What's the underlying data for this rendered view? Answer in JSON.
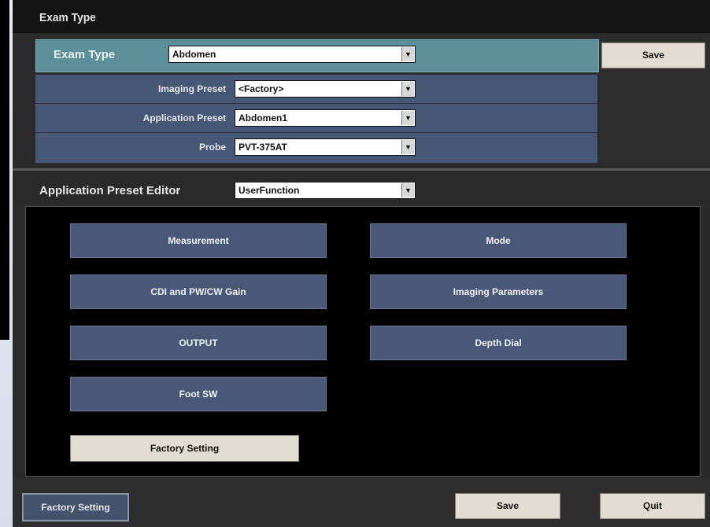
{
  "window": {
    "title": "Exam Type"
  },
  "exam_type": {
    "label": "Exam Type",
    "value": "Abdomen"
  },
  "presets": {
    "imaging_preset": {
      "label": "Imaging Preset",
      "value": "<Factory>"
    },
    "application_preset": {
      "label": "Application Preset",
      "value": "Abdomen1"
    },
    "probe": {
      "label": "Probe",
      "value": "PVT-375AT"
    }
  },
  "top_save_label": "Save",
  "editor": {
    "title": "Application Preset Editor",
    "selected": "UserFunction",
    "buttons": {
      "measurement": "Measurement",
      "mode": "Mode",
      "cdi_gain": "CDI and PW/CW Gain",
      "imaging_parameters": "Imaging Parameters",
      "output": "OUTPUT",
      "depth_dial": "Depth Dial",
      "foot_sw": "Foot SW"
    },
    "factory_setting_label": "Factory Setting"
  },
  "bottom": {
    "factory_setting_label": "Factory Setting",
    "save_label": "Save",
    "quit_label": "Quit"
  }
}
